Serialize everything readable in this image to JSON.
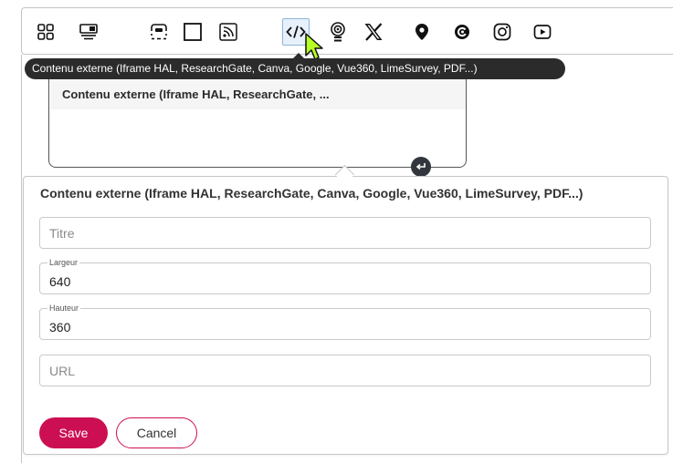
{
  "toolbar": {
    "icons": [
      "grid-icon",
      "template-icon",
      "placeholder-icon",
      "frame-icon",
      "rss-icon",
      "embed-code-icon",
      "podcast-icon",
      "x-icon",
      "location-pin-icon",
      "spiral-icon",
      "instagram-icon",
      "youtube-icon"
    ]
  },
  "tooltip": {
    "text": "Contenu externe (Iframe HAL, ResearchGate, Canva, Google, Vue360, LimeSurvey, PDF...)"
  },
  "widget": {
    "title": "Contenu externe (Iframe HAL, ResearchGate, ..."
  },
  "form": {
    "title": "Contenu externe (Iframe HAL, ResearchGate, Canva, Google, Vue360, LimeSurvey, PDF...)",
    "titre_placeholder": "Titre",
    "largeur_label": "Largeur",
    "largeur_value": "640",
    "hauteur_label": "Hauteur",
    "hauteur_value": "360",
    "url_placeholder": "URL",
    "save_label": "Save",
    "cancel_label": "Cancel"
  },
  "colors": {
    "primary": "#cc0f52",
    "tooltip_bg": "#2b2b2b",
    "active_bg": "#e7f0fb"
  }
}
